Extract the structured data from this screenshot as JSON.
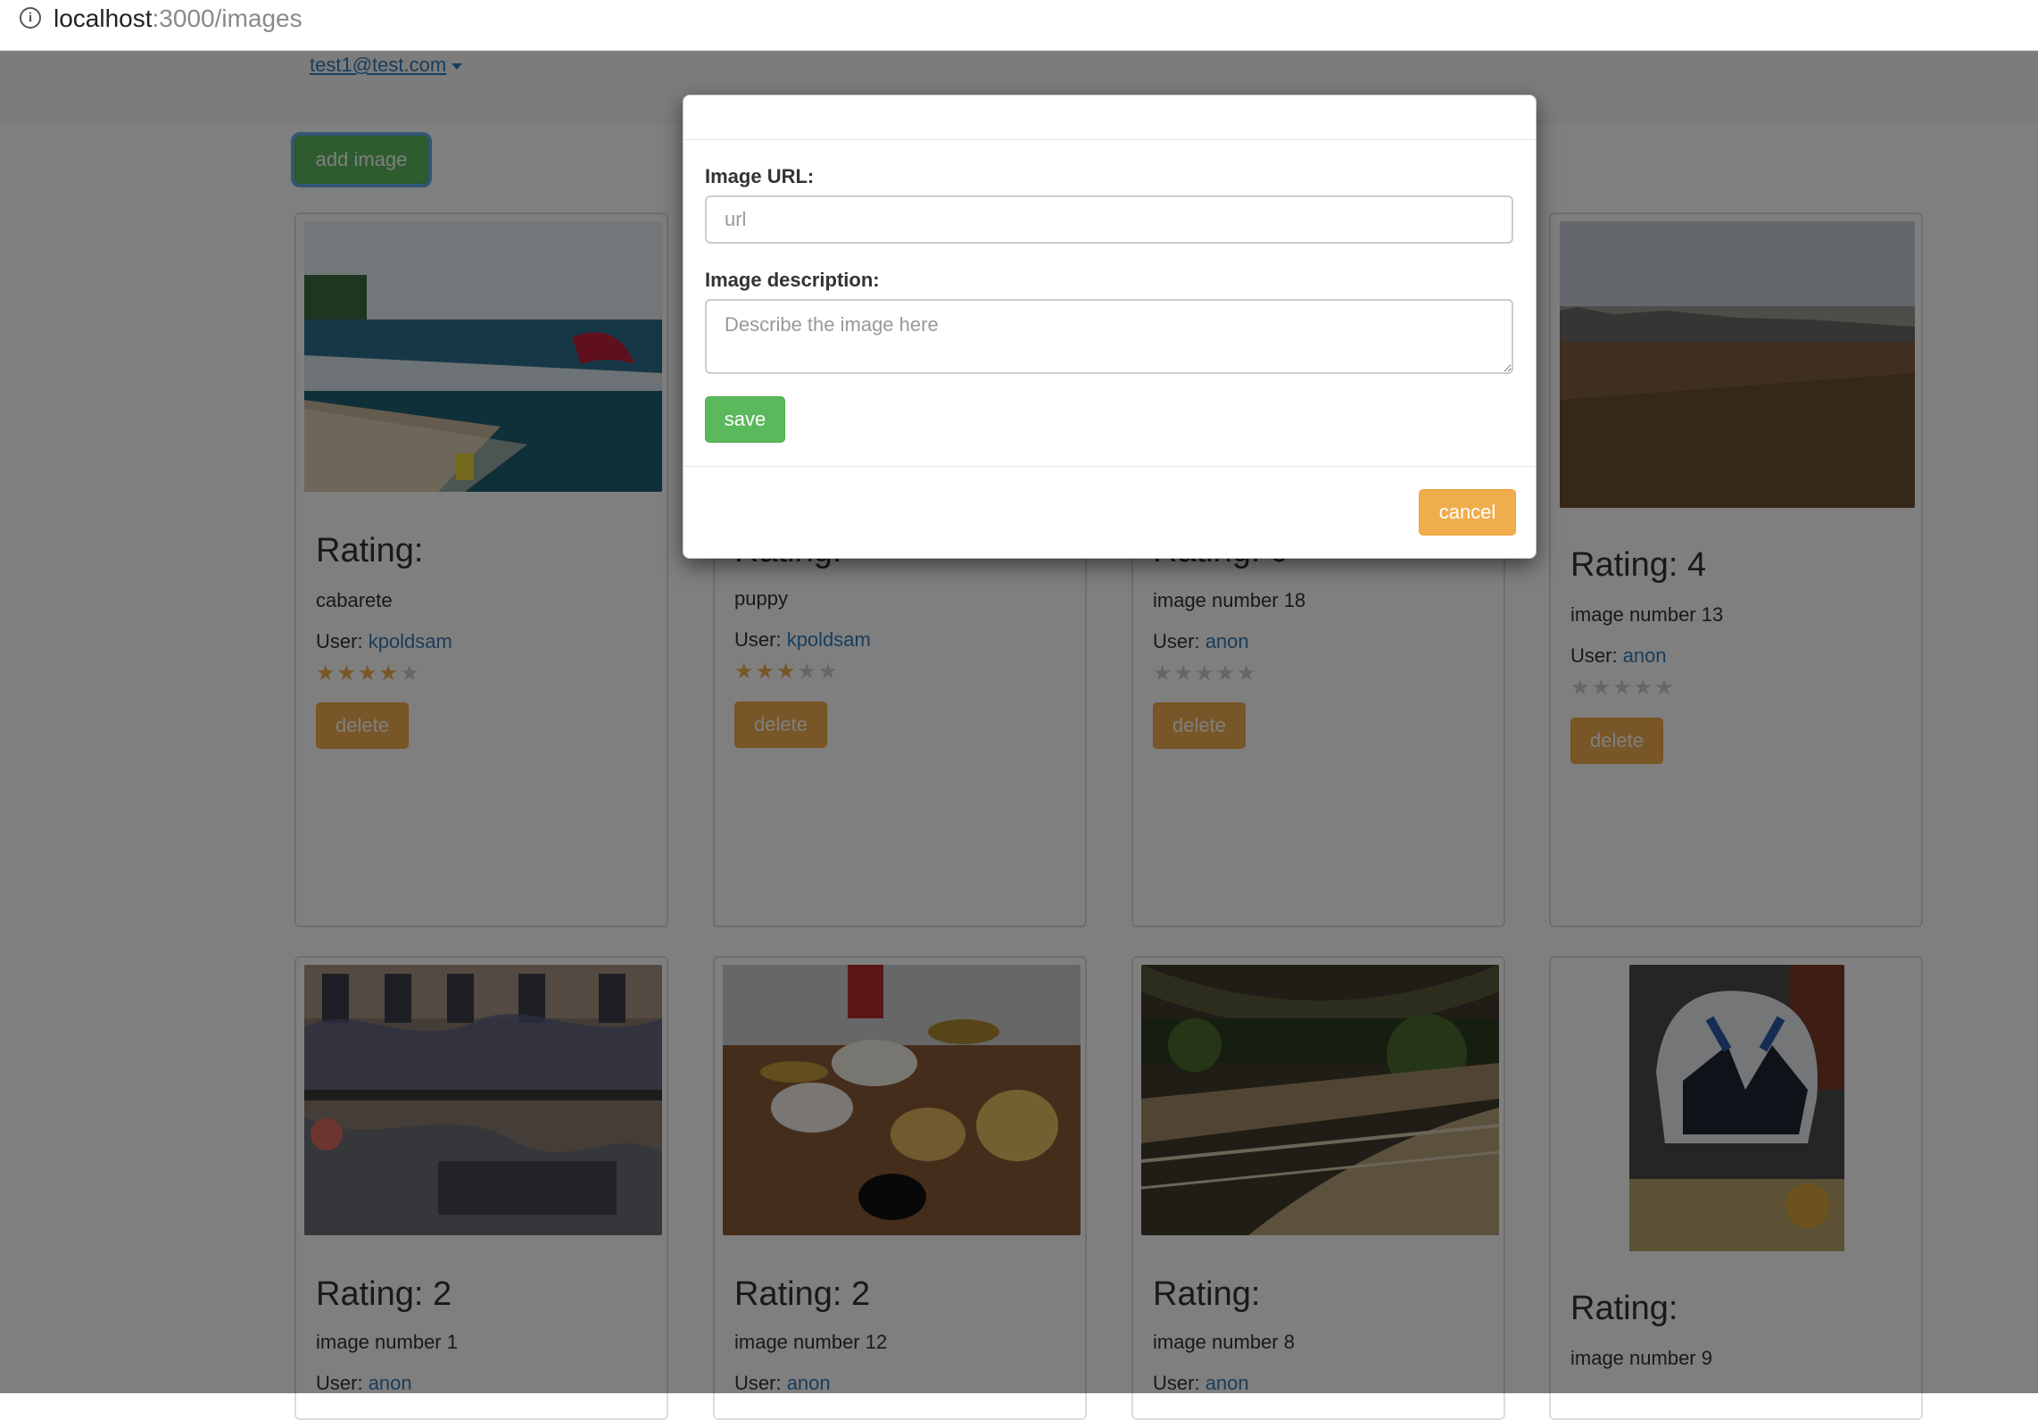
{
  "browser": {
    "url_host": "localhost",
    "url_path": ":3000/images"
  },
  "navbar": {
    "user_email": "test1@test.com"
  },
  "toolbar": {
    "add_image_label": "add image"
  },
  "cards": [
    {
      "rating_label": "Rating:",
      "description": "cabarete",
      "user_prefix": "User: ",
      "user": "kpoldsam",
      "stars_on": "★★★★",
      "stars_off": "★",
      "delete_label": "delete",
      "image": "kite-beach-photo"
    },
    {
      "rating_label": "Rating:",
      "description": "puppy",
      "user_prefix": "User: ",
      "user": "kpoldsam",
      "stars_on": "★★★",
      "stars_off": "★★",
      "delete_label": "delete",
      "image": "puppy-photo"
    },
    {
      "rating_label": "Rating: 0",
      "description": "image number 18",
      "user_prefix": "User: ",
      "user": "anon",
      "stars_on": "",
      "stars_off": "★★★★★",
      "delete_label": "delete",
      "image": "photo"
    },
    {
      "rating_label": "Rating: 4",
      "description": "image number 13",
      "user_prefix": "User: ",
      "user": "anon",
      "stars_on": "",
      "stars_off": "★★★★★",
      "delete_label": "delete",
      "image": "sandy-beach-photo"
    },
    {
      "rating_label": "Rating: 2",
      "description": "image number 1",
      "user_prefix": "User: ",
      "user": "anon",
      "image": "graffiti-building-photo"
    },
    {
      "rating_label": "Rating: 2",
      "description": "image number 12",
      "user_prefix": "User: ",
      "user": "anon",
      "image": "drum-kit-photo"
    },
    {
      "rating_label": "Rating:",
      "description": "image number 8",
      "user_prefix": "User: ",
      "user": "anon",
      "image": "indoor-garden-walkway-photo"
    },
    {
      "rating_label": "Rating:",
      "description": "image number 9",
      "image": "trooper-helmet-photo"
    }
  ],
  "modal": {
    "url_label": "Image URL:",
    "url_placeholder": "url",
    "desc_label": "Image description:",
    "desc_placeholder": "Describe the image here",
    "save_label": "save",
    "cancel_label": "cancel"
  },
  "colors": {
    "primary_link": "#337ab7",
    "success": "#5cb85c",
    "warning": "#f0ad4e"
  }
}
